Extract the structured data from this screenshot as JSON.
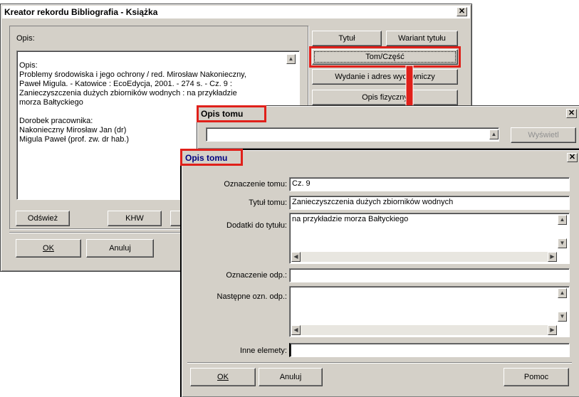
{
  "main": {
    "title": "Kreator rekordu Bibliografia - Książka",
    "opis_label": "Opis:",
    "opis_text": "Opis:\n  Problemy środowiska i jego ochrony / red. Mirosław Nakonieczny,\nPaweł Migula. - Katowice : EcoEdycja, 2001. - 274 s. - Cz. 9 :\nZanieczyszczenia dużych zbiorników wodnych : na przykładzie\nmorza Bałtyckiego\n\nDorobek pracownika:\n  Nakonieczny Mirosław Jan (dr)\n  Migula Paweł (prof. zw. dr hab.)",
    "buttons": {
      "tytul": "Tytuł",
      "wariant": "Wariant tytułu",
      "tom": "Tom/Część",
      "wydanie": "Wydanie i adres wydawniczy",
      "opis_fizyczny": "Opis fizyczny",
      "odswiez": "Odśwież",
      "khw": "KHW",
      "ok": "OK",
      "anuluj": "Anuluj"
    }
  },
  "opis_tomu_back": {
    "title": "Opis tomu",
    "wyswietl": "Wyświetl"
  },
  "opis_tomu": {
    "title": "Opis tomu",
    "fields": {
      "oznaczenie_tomu_label": "Oznaczenie tomu:",
      "oznaczenie_tomu_value": "Cz. 9",
      "tytul_tomu_label": "Tytuł tomu:",
      "tytul_tomu_value": "Zanieczyszczenia dużych zbiorników wodnych",
      "dodatki_label": "Dodatki do tytułu:",
      "dodatki_value": "na przykładzie morza Bałtyckiego",
      "oznaczenie_odp_label": "Oznaczenie odp.:",
      "oznaczenie_odp_value": "",
      "nastepne_label": "Następne ozn. odp.:",
      "nastepne_value": "",
      "inne_label": "Inne elemety:",
      "inne_value": ""
    },
    "buttons": {
      "ok": "OK",
      "anuluj": "Anuluj",
      "pomoc": "Pomoc"
    }
  },
  "colors": {
    "highlight": "#e0201a",
    "titlebar": "#000080",
    "face": "#d4d0c8"
  }
}
